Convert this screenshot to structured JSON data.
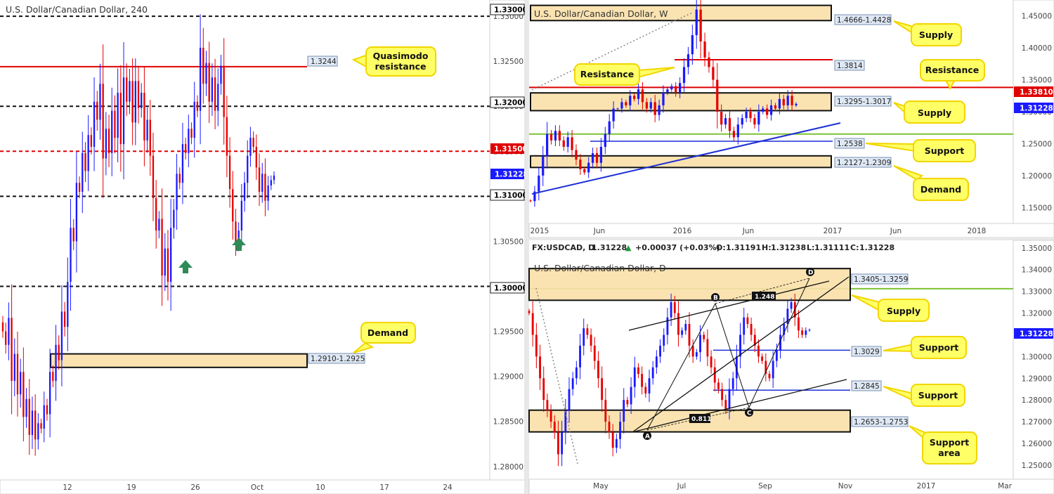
{
  "colors": {
    "up": "#1a1aff",
    "down": "#e60000",
    "zone_fill": "#f9e0a8",
    "callout_fill": "#ffff66",
    "callout_stroke": "#f2d500",
    "resistance": "#e00000",
    "support": "#1c2fd6",
    "green_line": "#7cc234",
    "price_badge": "#1a1aff",
    "arrow": "#2e8b57"
  },
  "chart_data": [
    {
      "id": "h4",
      "type": "candlestick",
      "title": "U.S. Dollar/Canadian Dollar, 240",
      "x_tick_labels": [
        "12",
        "19",
        "26",
        "Oct",
        "10",
        "17",
        "24"
      ],
      "y_tick_labels": [
        "1.28000",
        "1.28500",
        "1.29000",
        "1.29500",
        "1.30000",
        "1.30500",
        "1.31000",
        "1.31500",
        "1.32000",
        "1.32500",
        "1.33000"
      ],
      "ylim": [
        1.2785,
        1.3318
      ],
      "current_price": "1.31228",
      "levels": [
        {
          "price": 1.33,
          "label": "1.33000",
          "style": "black-dashed"
        },
        {
          "price": 1.3244,
          "label": "1.3244",
          "style": "red-solid"
        },
        {
          "price": 1.32,
          "label": "1.32000",
          "style": "black-dashed"
        },
        {
          "price": 1.315,
          "label": "1.31500",
          "style": "red-dashed"
        },
        {
          "price": 1.31,
          "label": "1.31000",
          "style": "black-dashed"
        },
        {
          "price": 1.3,
          "label": "1.30000",
          "style": "black-dashed"
        }
      ],
      "zones": [
        {
          "label": "1.2910-1.2925",
          "top": 1.2925,
          "bottom": 1.291
        }
      ],
      "callouts": [
        "Quasimodo\nresistance",
        "Demand"
      ],
      "series": [
        {
          "name": "USDCAD",
          "close_path": [
            1.295,
            1.2935,
            1.2965,
            1.2895,
            1.2925,
            1.288,
            1.2905,
            1.2855,
            1.2875,
            1.2835,
            1.2862,
            1.283,
            1.2848,
            1.2842,
            1.2868,
            1.2858,
            1.2905,
            1.2895,
            1.2935,
            1.2918,
            1.2972,
            1.2955,
            1.3005,
            1.3065,
            1.305,
            1.3115,
            1.3105,
            1.3148,
            1.3128,
            1.3168,
            1.3155,
            1.3205,
            1.3185,
            1.3225,
            1.3142,
            1.3175,
            1.3148,
            1.3195,
            1.3165,
            1.3215,
            1.3158,
            1.3232,
            1.3205,
            1.3228,
            1.3182,
            1.3228,
            1.3198,
            1.3215,
            1.3162,
            1.3185,
            1.3145,
            1.3098,
            1.3062,
            1.3075,
            1.3012,
            1.3042,
            1.3005,
            1.3065,
            1.3085,
            1.3125,
            1.3115,
            1.3158,
            1.3148,
            1.3175,
            1.3165,
            1.3205,
            1.3195,
            1.3265,
            1.3225,
            1.3248,
            1.3205,
            1.3232,
            1.3195,
            1.3225,
            1.3245,
            1.3188,
            1.3145,
            1.3108,
            1.3072,
            1.3048,
            1.3062,
            1.3095,
            1.3115,
            1.3145,
            1.3165,
            1.3155,
            1.3132,
            1.3105,
            1.3125,
            1.3095,
            1.3112,
            1.3118,
            1.3123
          ]
        }
      ]
    },
    {
      "id": "weekly",
      "type": "candlestick",
      "title": "U.S. Dollar/Canadian Dollar, W",
      "x_tick_labels": [
        "2015",
        "Jun",
        "2016",
        "Jun",
        "2017",
        "Jun",
        "2018"
      ],
      "y_tick_labels": [
        "1.15000",
        "1.20000",
        "1.25000",
        "1.30000",
        "1.35000",
        "1.40000",
        "1.45000"
      ],
      "ylim": [
        1.125,
        1.475
      ],
      "current_price": "1.31228",
      "resistance_price": "1.33810",
      "levels": [
        {
          "price": 1.3381,
          "label": "",
          "style": "red-solid"
        },
        {
          "price": 1.3814,
          "label": "1.3814",
          "style": "red-solid-short"
        },
        {
          "price": 1.2538,
          "label": "1.2538",
          "style": "blue-solid"
        },
        {
          "price": 1.265,
          "label": "",
          "style": "green-solid"
        }
      ],
      "zones": [
        {
          "label": "1.4666-1.4428",
          "top": 1.4666,
          "bottom": 1.4428
        },
        {
          "label": "1.3295-1.3017",
          "top": 1.3295,
          "bottom": 1.3017
        },
        {
          "label": "1.2127-1.2309",
          "top": 1.2309,
          "bottom": 1.2127
        }
      ],
      "callouts": [
        "Supply",
        "Resistance",
        "Resistance",
        "Supply",
        "Support",
        "Demand"
      ],
      "series": [
        {
          "name": "USDCAD",
          "close_path": [
            1.16,
            1.175,
            1.2,
            1.23,
            1.265,
            1.255,
            1.27,
            1.255,
            1.245,
            1.26,
            1.24,
            1.225,
            1.21,
            1.205,
            1.22,
            1.235,
            1.22,
            1.245,
            1.265,
            1.285,
            1.305,
            1.305,
            1.315,
            1.31,
            1.325,
            1.32,
            1.335,
            1.315,
            1.305,
            1.315,
            1.295,
            1.31,
            1.33,
            1.335,
            1.34,
            1.33,
            1.345,
            1.37,
            1.39,
            1.42,
            1.46,
            1.41,
            1.385,
            1.37,
            1.35,
            1.3,
            1.28,
            1.29,
            1.27,
            1.26,
            1.28,
            1.29,
            1.3,
            1.29,
            1.28,
            1.3,
            1.305,
            1.295,
            1.31,
            1.305,
            1.32,
            1.31,
            1.325,
            1.31,
            1.3123
          ]
        }
      ]
    },
    {
      "id": "daily",
      "type": "candlestick",
      "title": "U.S. Dollar/Canadian Dollar, D",
      "header_symbol": "FX:USDCAD, D",
      "ohlc": {
        "last": "1.31228",
        "change": "+0.00037 (+0.03%)",
        "o": "1.31191",
        "h": "1.31238",
        "l": "1.31111",
        "c": "1.31228"
      },
      "x_tick_labels": [
        "May",
        "Jul",
        "Sep",
        "Nov",
        "2017",
        "Mar"
      ],
      "y_tick_labels": [
        "1.25000",
        "1.26000",
        "1.27000",
        "1.28000",
        "1.29000",
        "1.30000",
        "1.31000",
        "1.32000",
        "1.33000",
        "1.34000",
        "1.35000"
      ],
      "ylim": [
        1.2435,
        1.3535
      ],
      "current_price": "1.31228",
      "levels": [
        {
          "price": 1.3029,
          "label": "1.3029",
          "style": "blue-solid"
        },
        {
          "price": 1.2845,
          "label": "1.2845",
          "style": "blue-solid"
        },
        {
          "price": 1.3312,
          "label": "",
          "style": "green-solid"
        }
      ],
      "zones": [
        {
          "label": "1.3405-1.3259",
          "top": 1.3405,
          "bottom": 1.3259
        },
        {
          "label": "1.2653-1.2753",
          "top": 1.2753,
          "bottom": 1.2653
        }
      ],
      "pattern_points": [
        "A",
        "B",
        "C",
        "D"
      ],
      "pattern_ratios": [
        "1.248",
        "0.811"
      ],
      "callouts": [
        "Supply",
        "Support",
        "Support",
        "Support\narea"
      ],
      "series": [
        {
          "name": "USDCAD",
          "close_path": [
            1.32,
            1.31,
            1.3,
            1.29,
            1.28,
            1.275,
            1.27,
            1.265,
            1.255,
            1.265,
            1.275,
            1.285,
            1.29,
            1.295,
            1.305,
            1.313,
            1.31,
            1.305,
            1.298,
            1.29,
            1.28,
            1.27,
            1.265,
            1.258,
            1.262,
            1.27,
            1.28,
            1.278,
            1.286,
            1.295,
            1.292,
            1.286,
            1.283,
            1.29,
            1.295,
            1.3,
            1.305,
            1.31,
            1.318,
            1.325,
            1.32,
            1.31,
            1.312,
            1.315,
            1.305,
            1.3,
            1.302,
            1.31,
            1.308,
            1.3,
            1.295,
            1.288,
            1.285,
            1.28,
            1.276,
            1.285,
            1.29,
            1.3,
            1.31,
            1.318,
            1.315,
            1.31,
            1.305,
            1.3,
            1.298,
            1.292,
            1.29,
            1.298,
            1.303,
            1.31,
            1.315,
            1.322,
            1.325,
            1.318,
            1.312,
            1.31,
            1.312,
            1.3123
          ]
        }
      ]
    }
  ]
}
